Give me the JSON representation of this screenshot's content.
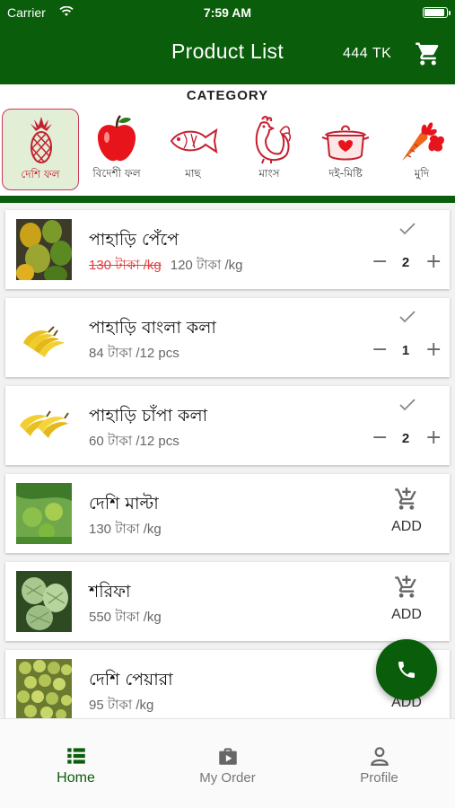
{
  "status_bar": {
    "carrier": "Carrier",
    "time": "7:59 AM"
  },
  "app_bar": {
    "title": "Product List",
    "balance": "444 TK",
    "cart_icon": "cart-icon"
  },
  "category": {
    "heading": "CATEGORY",
    "selected": "দেশি ফল",
    "items": [
      {
        "label": "দেশি ফল",
        "icon": "pineapple-icon"
      },
      {
        "label": "বিদেশী ফল",
        "icon": "apple-icon"
      },
      {
        "label": "মাছ",
        "icon": "fish-icon"
      },
      {
        "label": "মাংস",
        "icon": "rooster-icon"
      },
      {
        "label": "দই-মিষ্টি",
        "icon": "sweet-pot-icon"
      },
      {
        "label": "মুদি",
        "icon": "vegetable-icon"
      }
    ]
  },
  "products": [
    {
      "name": "পাহাড়ি পেঁপে",
      "old_price": "130 টাকা /kg",
      "price": "120 টাকা /kg",
      "quantity": "2",
      "in_cart": true
    },
    {
      "name": "পাহাড়ি বাংলা কলা",
      "old_price": "",
      "price": "84 টাকা /12 pcs",
      "quantity": "1",
      "in_cart": true
    },
    {
      "name": "পাহাড়ি চাঁপা কলা",
      "old_price": "",
      "price": "60 টাকা /12 pcs",
      "quantity": "2",
      "in_cart": true
    },
    {
      "name": "দেশি মাল্টা",
      "old_price": "",
      "price": "130 টাকা /kg",
      "add_label": "ADD",
      "in_cart": false
    },
    {
      "name": "শরিফা",
      "old_price": "",
      "price": "550 টাকা /kg",
      "add_label": "ADD",
      "in_cart": false
    },
    {
      "name": "দেশি পেয়ারা",
      "old_price": "",
      "price": "95 টাকা /kg",
      "add_label": "ADD",
      "in_cart": false
    }
  ],
  "fab": {
    "icon": "phone-icon"
  },
  "bottom_nav": {
    "active": "Home",
    "items": [
      {
        "label": "Home",
        "icon": "home-list-icon"
      },
      {
        "label": "My Order",
        "icon": "order-bag-icon"
      },
      {
        "label": "Profile",
        "icon": "profile-icon"
      }
    ]
  },
  "colors": {
    "primary": "#0a5d0a",
    "strike_price": "#e04040",
    "selected_category_bg": "#e3eed6",
    "selected_category_border": "#c83a5a"
  }
}
